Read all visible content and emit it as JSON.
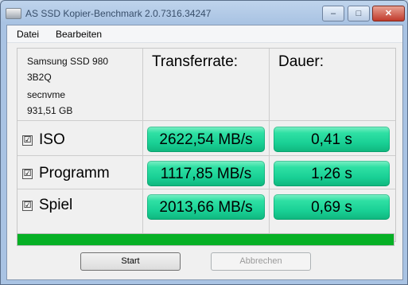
{
  "window": {
    "title": "AS SSD Kopier-Benchmark 2.0.7316.34247",
    "controls": {
      "minimize": "–",
      "maximize": "□",
      "close": "✕"
    }
  },
  "menu": {
    "items": [
      "Datei",
      "Bearbeiten"
    ]
  },
  "drive": {
    "model": "Samsung SSD 980",
    "firmware": "3B2Q",
    "driver": "secnvme",
    "capacity": "931,51 GB"
  },
  "table": {
    "headers": {
      "rate": "Transferrate:",
      "duration": "Dauer:"
    },
    "rows": [
      {
        "checked": true,
        "label": "ISO",
        "rate": "2622,54 MB/s",
        "duration": "0,41 s"
      },
      {
        "checked": true,
        "label": "Programm",
        "rate": "1117,85 MB/s",
        "duration": "1,26 s"
      },
      {
        "checked": true,
        "label": "Spiel",
        "rate": "2013,66 MB/s",
        "duration": "0,69 s"
      }
    ]
  },
  "progress": {
    "value": 1.0,
    "color": "#06b025"
  },
  "buttons": {
    "start": "Start",
    "cancel": "Abbrechen"
  },
  "icons": {
    "checkbox": "☑",
    "app": "drive-icon"
  }
}
